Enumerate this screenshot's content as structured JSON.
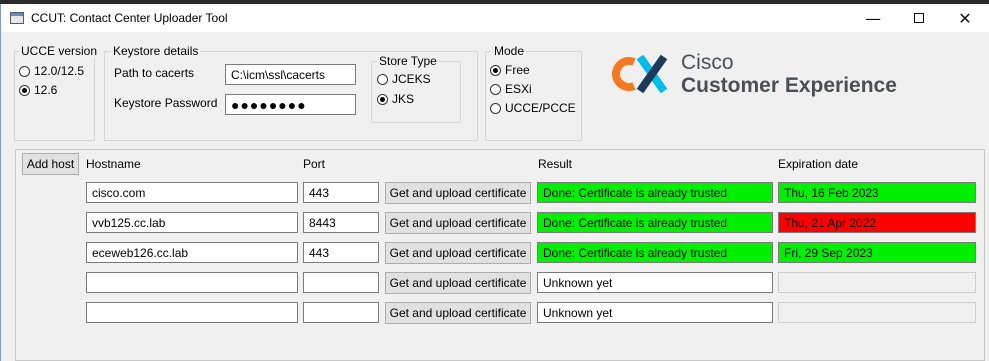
{
  "window": {
    "title": "CCUT: Contact Center Uploader Tool",
    "minimize_icon": "minimize-icon",
    "maximize_icon": "maximize-icon",
    "close_icon": "close-icon"
  },
  "ucce_version": {
    "label": "UCCE version",
    "options": [
      {
        "label": "12.0/12.5",
        "checked": false
      },
      {
        "label": "12.6",
        "checked": true
      }
    ]
  },
  "keystore": {
    "label": "Keystore details",
    "path_label": "Path to cacerts",
    "path_value": "C:\\icm\\ssl\\cacerts",
    "password_label": "Keystore Password",
    "password_value": "●●●●●●●●"
  },
  "store_type": {
    "label": "Store Type",
    "options": [
      {
        "label": "JCEKS",
        "checked": false
      },
      {
        "label": "JKS",
        "checked": true
      }
    ]
  },
  "mode": {
    "label": "Mode",
    "options": [
      {
        "label": "Free",
        "checked": true
      },
      {
        "label": "ESXi",
        "checked": false
      },
      {
        "label": "UCCE/PCCE",
        "checked": false
      }
    ]
  },
  "logo": {
    "line1": "Cisco",
    "line2": "Customer Experience",
    "colors": {
      "orange": "#f47920",
      "teal": "#00bceb",
      "navy": "#1b3a5c",
      "text": "#4a4f55"
    }
  },
  "table": {
    "add_host_label": "Add host",
    "headers": {
      "hostname": "Hostname",
      "port": "Port",
      "result": "Result",
      "expiration": "Expiration date"
    },
    "action_label": "Get and upload certificate",
    "rows": [
      {
        "hostname": "cisco.com",
        "port": "443",
        "result": "Done: Certificate is already trusted",
        "result_status": "ok",
        "expiration": "Thu, 16 Feb 2023",
        "expiration_status": "ok"
      },
      {
        "hostname": "vvb125.cc.lab",
        "port": "8443",
        "result": "Done: Certificate is already trusted",
        "result_status": "ok",
        "expiration": "Thu, 21 Apr 2022",
        "expiration_status": "bad"
      },
      {
        "hostname": "eceweb126.cc.lab",
        "port": "443",
        "result": "Done: Certificate is already trusted",
        "result_status": "ok",
        "expiration": "Fri, 29 Sep 2023",
        "expiration_status": "ok"
      },
      {
        "hostname": "",
        "port": "",
        "result": "Unknown yet",
        "result_status": "none",
        "expiration": "",
        "expiration_status": "dis"
      },
      {
        "hostname": "",
        "port": "",
        "result": "Unknown yet",
        "result_status": "none",
        "expiration": "",
        "expiration_status": "dis"
      }
    ]
  },
  "colors": {
    "ok": "#00f000",
    "expired": "#ff0000"
  }
}
